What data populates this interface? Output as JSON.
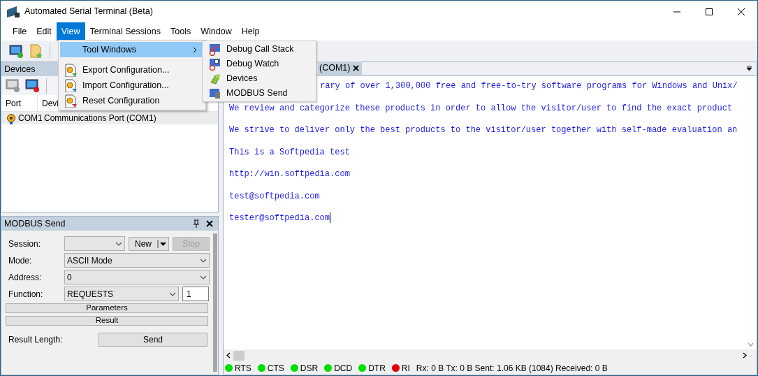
{
  "window": {
    "title": "Automated Serial Terminal (Beta)"
  },
  "menu_bar": [
    {
      "label": "File",
      "selected": false
    },
    {
      "label": "Edit",
      "selected": false
    },
    {
      "label": "View",
      "selected": true
    },
    {
      "label": "Terminal Sessions",
      "selected": false
    },
    {
      "label": "Tools",
      "selected": false
    },
    {
      "label": "Window",
      "selected": false
    },
    {
      "label": "Help",
      "selected": false
    }
  ],
  "view_menu": [
    {
      "label": "Tool Windows",
      "kind": "submenu",
      "selected": true
    },
    {
      "label": "Export Configuration...",
      "kind": "export",
      "selected": false
    },
    {
      "label": "Import Configuration...",
      "kind": "import",
      "selected": false
    },
    {
      "label": "Reset Configuration",
      "kind": "reset",
      "selected": false
    }
  ],
  "tool_windows_submenu": [
    {
      "label": "Debug Call Stack",
      "kind": "stack"
    },
    {
      "label": "Debug Watch",
      "kind": "watch"
    },
    {
      "label": "Devices",
      "kind": "devices"
    },
    {
      "label": "MODBUS Send",
      "kind": "modbus"
    }
  ],
  "devices_panel": {
    "title": "Devices",
    "columns": [
      "Port",
      "Devi"
    ],
    "rows": [
      {
        "port": "COM1",
        "device": "Communications Port (COM1)",
        "selected": true
      }
    ]
  },
  "modbus_panel": {
    "title": "MODBUS Send",
    "session": {
      "label": "Session:"
    },
    "new_button": "New",
    "stop_button": {
      "label": "Stop",
      "disabled": true
    },
    "mode": {
      "label": "Mode:",
      "value": "ASCII Mode"
    },
    "address": {
      "label": "Address:",
      "value": "0"
    },
    "function": {
      "label": "Function:",
      "value": "REQUESTS",
      "count": "1"
    },
    "sections": [
      "Parameters",
      "Result"
    ],
    "result_length": {
      "label": "Result Length:"
    },
    "send_button": "Send"
  },
  "terminal": {
    "tab": {
      "label": "(COM1)",
      "selected": true
    },
    "lines": [
      "rary of over 1,300,000 free and free-to-try software programs for Windows and Unix/",
      "We review and categorize these products in order to allow the visitor/user to find the exact product",
      "We strive to deliver only the best products to the visitor/user together with self-made evaluation an",
      "This is a Softpedia test",
      "http://win.softpedia.com",
      "test@softpedia.com",
      "tester@softpedia.com"
    ]
  },
  "status_bar": {
    "signals": [
      {
        "label": "RTS",
        "color": "#00e000"
      },
      {
        "label": "CTS",
        "color": "#00e000"
      },
      {
        "label": "DSR",
        "color": "#00e000"
      },
      {
        "label": "DCD",
        "color": "#00e000"
      },
      {
        "label": "DTR",
        "color": "#00e000"
      },
      {
        "label": "RI",
        "color": "#e00000"
      }
    ],
    "counters": "Rx: 0 B Tx: 0 B Sent: 1.06 KB (1084) Received: 0 B"
  }
}
